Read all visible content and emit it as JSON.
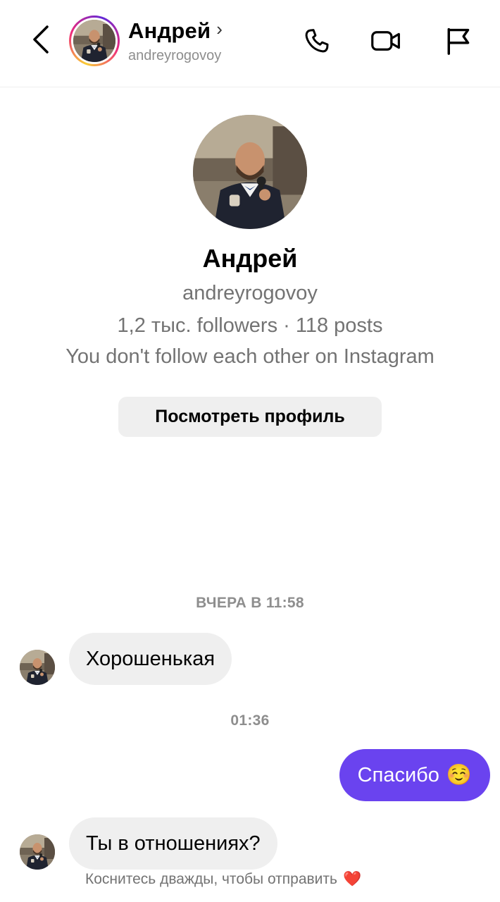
{
  "header": {
    "name": "Андрей",
    "username": "andreyrogovoy",
    "chevron": "›",
    "icons": {
      "back": "back-arrow-icon",
      "call": "phone-icon",
      "video": "video-camera-icon",
      "report": "flag-icon"
    }
  },
  "profile": {
    "name": "Андрей",
    "username": "andreyrogovoy",
    "stats": "1,2 тыс. followers · 118 posts",
    "note": "You don't follow each other on Instagram",
    "view_button": "Посмотреть профиль"
  },
  "chat": {
    "timestamp1": "ВЧЕРА В 11:58",
    "message1": "Хорошенькая",
    "timestamp2": "01:36",
    "reply": "Спасибо",
    "reply_emoji": "☺️",
    "message2": "Ты в отношениях?",
    "hint": "Коснитесь дважды, чтобы отправить",
    "hint_emoji": "❤️"
  },
  "colors": {
    "accent": "#6a43ef",
    "bubble_in": "#efefef",
    "secondary_text": "#737373"
  }
}
